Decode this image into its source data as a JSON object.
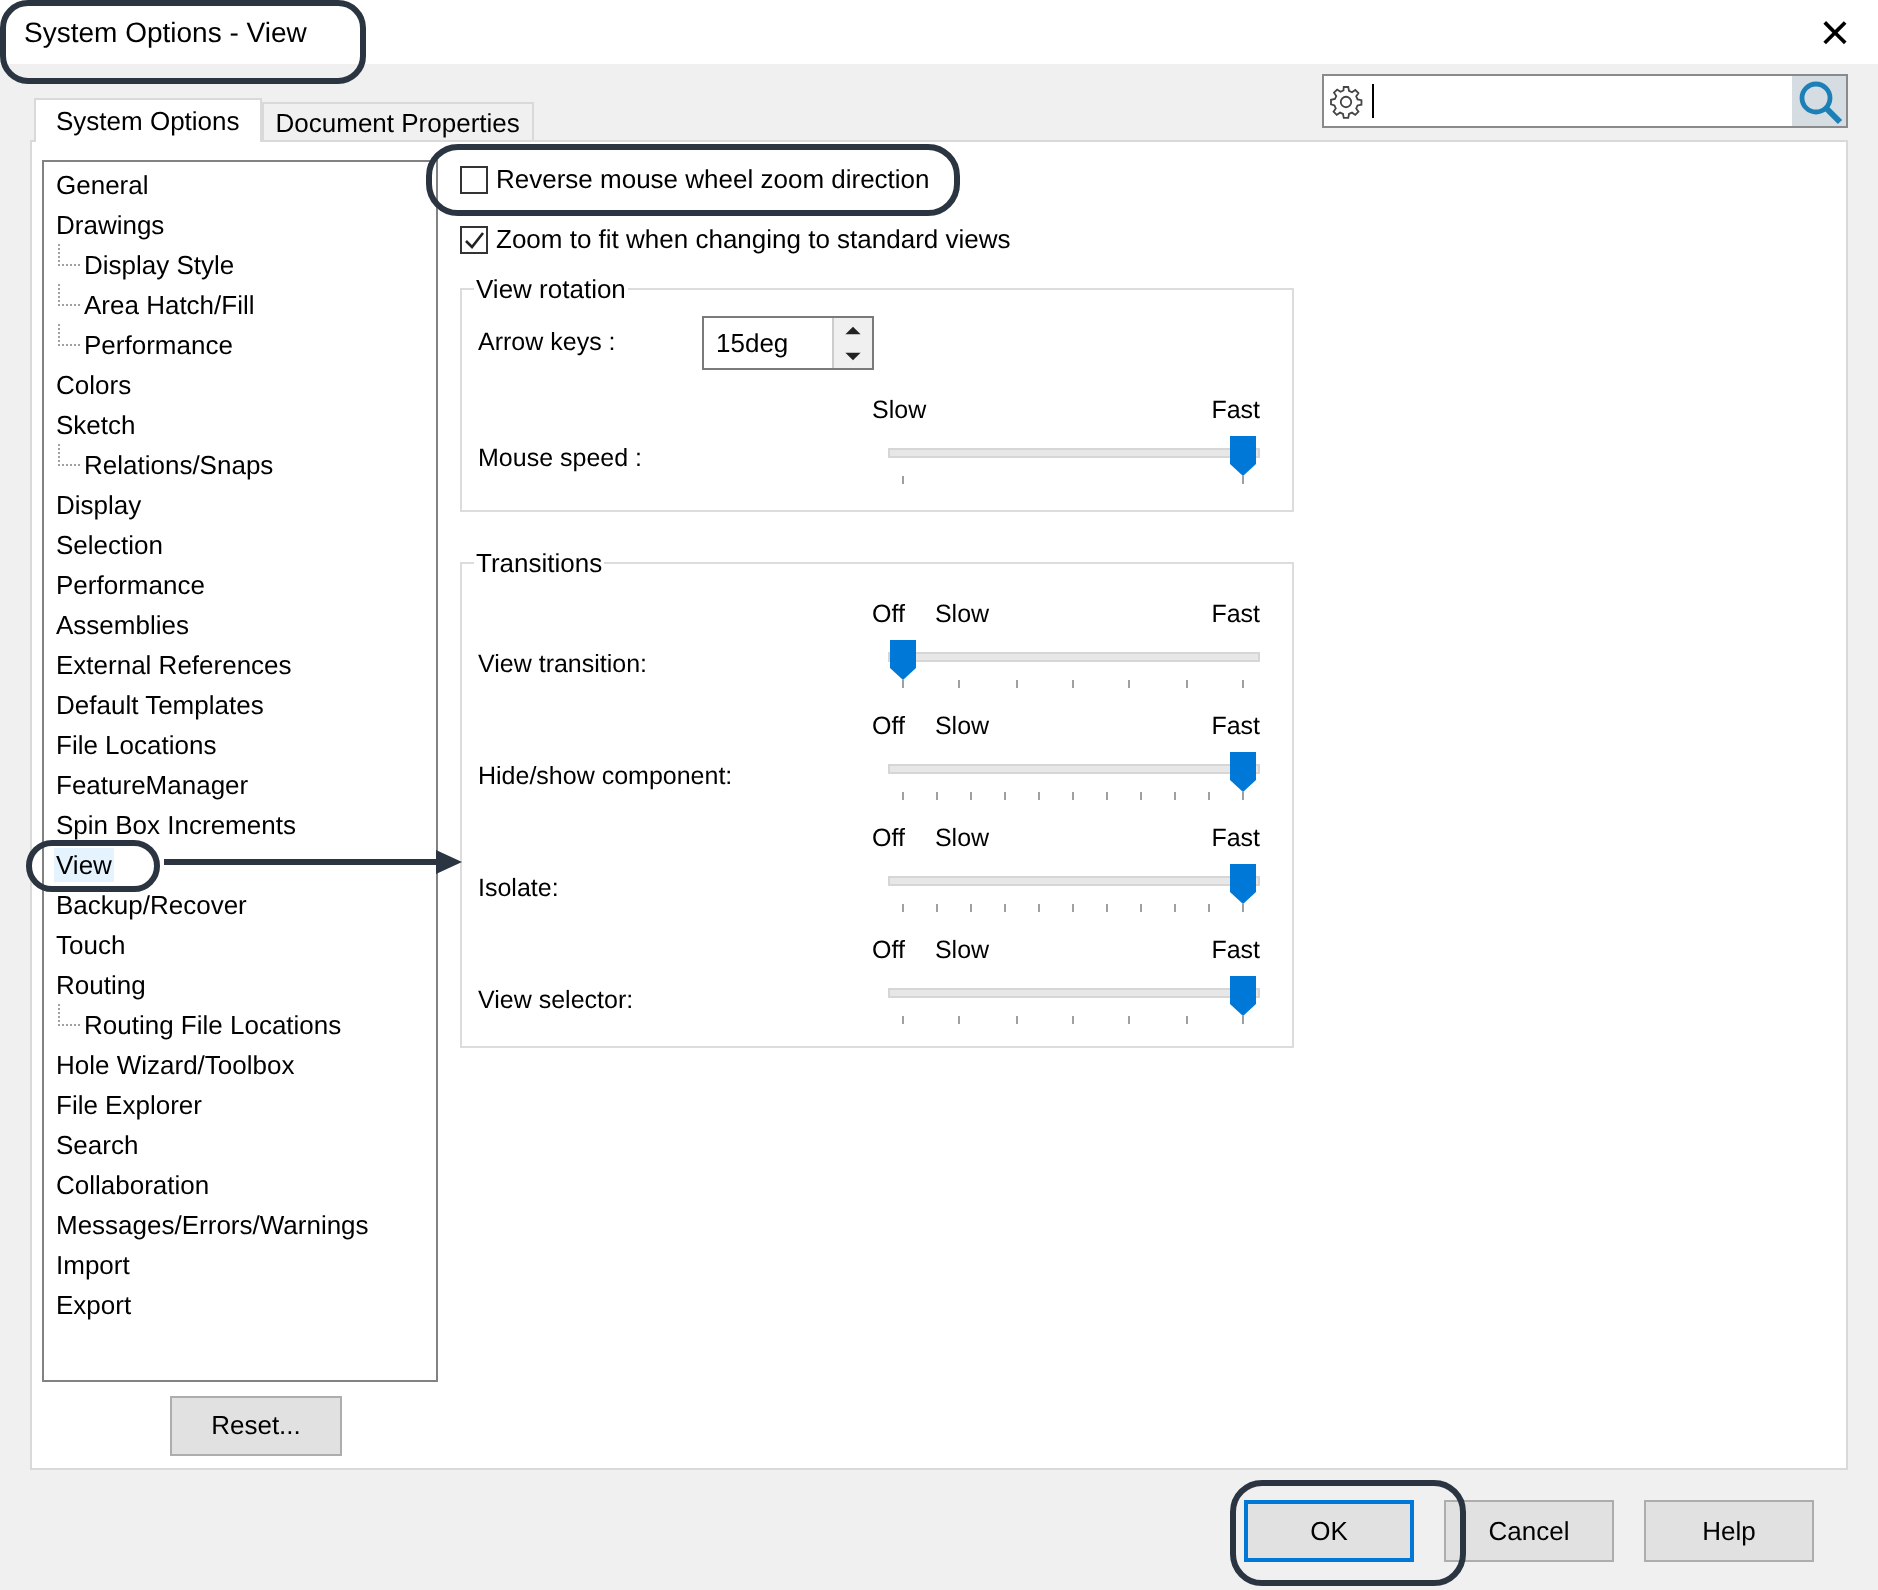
{
  "window": {
    "title": "System Options - View",
    "close": "×"
  },
  "tabs": [
    {
      "label": "System Options",
      "selected": true
    },
    {
      "label": "Document Properties",
      "selected": false
    }
  ],
  "tree": [
    {
      "label": "General",
      "selected": false
    },
    {
      "label": "Drawings",
      "selected": false,
      "children": [
        {
          "label": "Display Style",
          "selected": false
        },
        {
          "label": "Area Hatch/Fill",
          "selected": false
        },
        {
          "label": "Performance",
          "selected": false
        }
      ]
    },
    {
      "label": "Colors",
      "selected": false
    },
    {
      "label": "Sketch",
      "selected": false,
      "children": [
        {
          "label": "Relations/Snaps",
          "selected": false
        }
      ]
    },
    {
      "label": "Display",
      "selected": false
    },
    {
      "label": "Selection",
      "selected": false
    },
    {
      "label": "Performance",
      "selected": false
    },
    {
      "label": "Assemblies",
      "selected": false
    },
    {
      "label": "External References",
      "selected": false
    },
    {
      "label": "Default Templates",
      "selected": false
    },
    {
      "label": "File Locations",
      "selected": false
    },
    {
      "label": "FeatureManager",
      "selected": false
    },
    {
      "label": "Spin Box Increments",
      "selected": false
    },
    {
      "label": "View",
      "selected": true
    },
    {
      "label": "Backup/Recover",
      "selected": false
    },
    {
      "label": "Touch",
      "selected": false
    },
    {
      "label": "Routing",
      "selected": false,
      "children": [
        {
          "label": "Routing File Locations",
          "selected": false
        }
      ]
    },
    {
      "label": "Hole Wizard/Toolbox",
      "selected": false
    },
    {
      "label": "File Explorer",
      "selected": false
    },
    {
      "label": "Search",
      "selected": false
    },
    {
      "label": "Collaboration",
      "selected": false
    },
    {
      "label": "Messages/Errors/Warnings",
      "selected": false
    },
    {
      "label": "Import",
      "selected": false
    },
    {
      "label": "Export",
      "selected": false
    }
  ],
  "reset_button": "Reset...",
  "checkboxes": [
    {
      "label": "Reverse mouse wheel zoom direction",
      "checked": false
    },
    {
      "label": "Zoom to fit when changing to standard views",
      "checked": true
    }
  ],
  "view_rotation": {
    "title": "View rotation",
    "arrow_keys": {
      "label": "Arrow keys :",
      "value": "15deg"
    },
    "mouse_speed": {
      "label": "Mouse speed :",
      "left_labels": [
        "Slow"
      ],
      "right_label": "Fast",
      "level": 1,
      "kind": "ends"
    }
  },
  "transitions": {
    "title": "Transitions",
    "sliders": [
      {
        "label": "View transition:",
        "left_labels": [
          "Off",
          "Slow"
        ],
        "right_label": "Fast",
        "level": 0,
        "kind": "coarse"
      },
      {
        "label": "Hide/show component:",
        "left_labels": [
          "Off",
          "Slow"
        ],
        "right_label": "Fast",
        "level": 1,
        "kind": "fine"
      },
      {
        "label": "Isolate:",
        "left_labels": [
          "Off",
          "Slow"
        ],
        "right_label": "Fast",
        "level": 1,
        "kind": "fine"
      },
      {
        "label": "View selector:",
        "left_labels": [
          "Off",
          "Slow"
        ],
        "right_label": "Fast",
        "level": 1,
        "kind": "coarse"
      }
    ]
  },
  "buttons": [
    {
      "label": "OK",
      "default": true
    },
    {
      "label": "Cancel",
      "default": false
    },
    {
      "label": "Help",
      "default": false
    }
  ]
}
